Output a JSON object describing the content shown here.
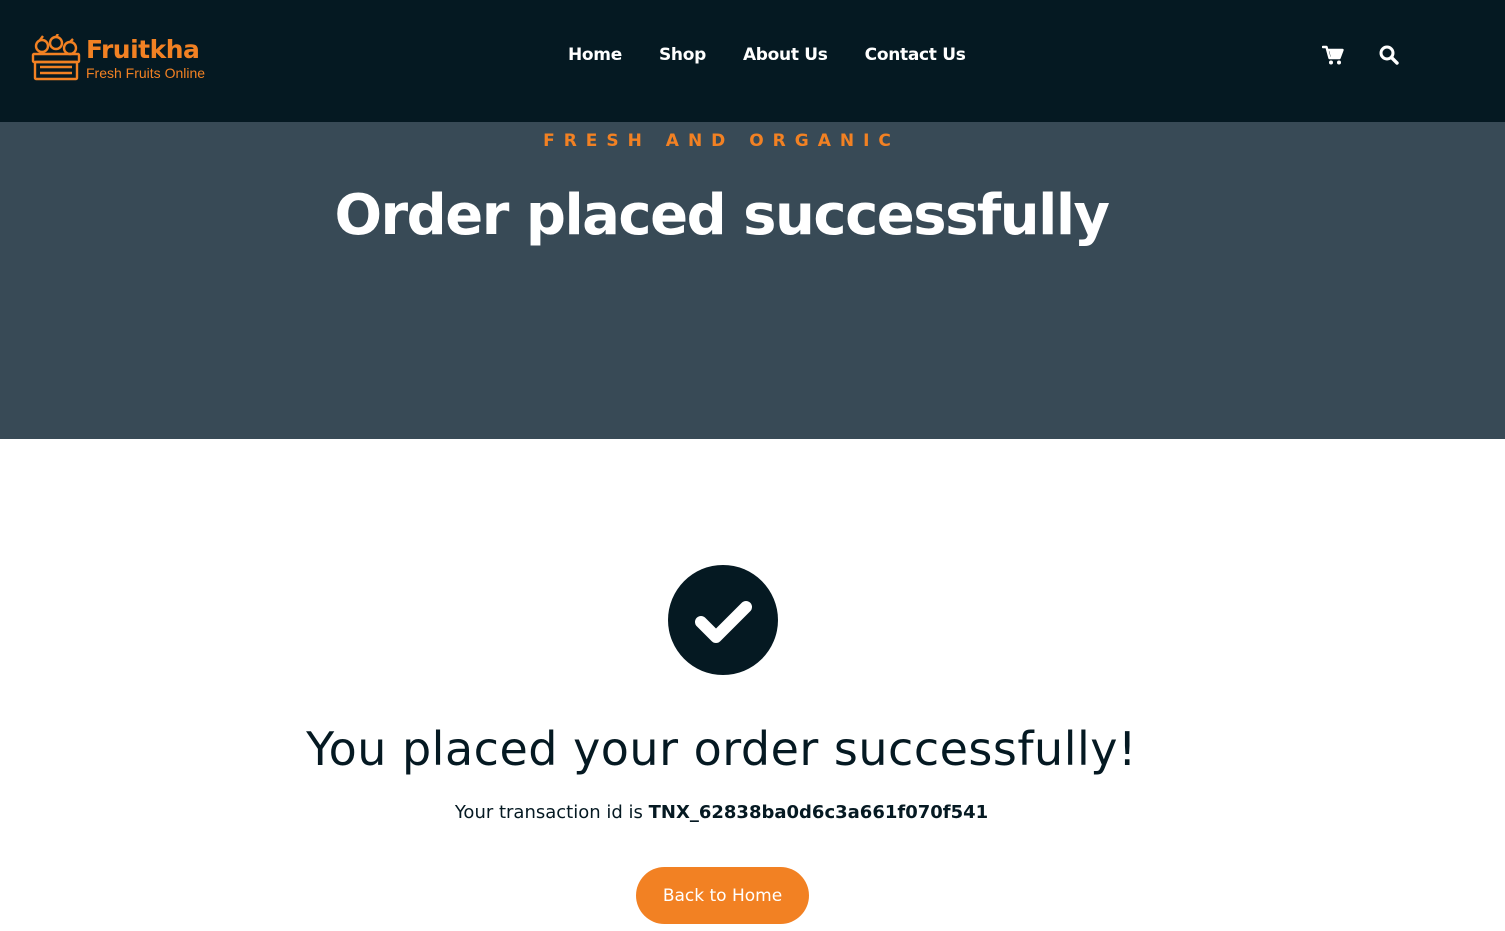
{
  "brand": {
    "name": "Fruitkha",
    "tagline": "Fresh Fruits Online",
    "accent_color": "#F28123",
    "dark_color": "#051922",
    "hero_bg_color": "#384A56"
  },
  "nav": {
    "items": [
      {
        "label": "Home"
      },
      {
        "label": "Shop"
      },
      {
        "label": "About Us"
      },
      {
        "label": "Contact Us"
      }
    ],
    "icons": [
      "cart-icon",
      "search-icon"
    ]
  },
  "hero": {
    "subtitle": "FRESH AND ORGANIC",
    "title": "Order placed successfully"
  },
  "success": {
    "icon": "check-circle-icon",
    "heading": "You placed your order successfully!",
    "transaction_label": "Your transaction id is",
    "transaction_id": "TNX_62838ba0d6c3a661f070f541",
    "back_button_label": "Back to Home"
  }
}
